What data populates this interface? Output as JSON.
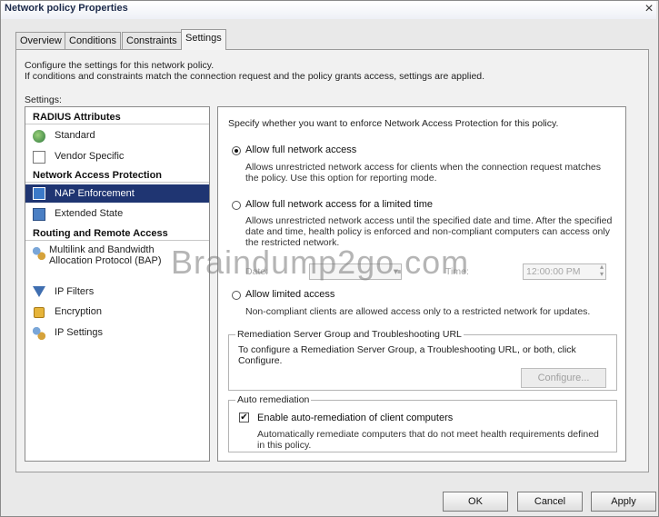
{
  "window": {
    "title": "Network policy Properties",
    "close_glyph": "×"
  },
  "tabs": [
    "Overview",
    "Conditions",
    "Constraints",
    "Settings"
  ],
  "active_tab": "Settings",
  "intro": {
    "line1": "Configure the settings for this network policy.",
    "line2": "If conditions and constraints match the connection request and the policy grants access, settings are applied."
  },
  "settings_label": "Settings:",
  "sidebar": {
    "sections": [
      {
        "title": "RADIUS Attributes",
        "items": [
          "Standard",
          "Vendor Specific"
        ]
      },
      {
        "title": "Network Access Protection",
        "items": [
          "NAP Enforcement",
          "Extended State"
        ]
      },
      {
        "title": "Routing and Remote Access",
        "items": [
          "Multilink and Bandwidth Allocation Protocol (BAP)",
          "IP Filters",
          "Encryption",
          "IP Settings"
        ]
      }
    ],
    "bap_line1": "Multilink and Bandwidth",
    "bap_line2": "Allocation Protocol (BAP)",
    "selected": "NAP Enforcement"
  },
  "main": {
    "heading": "Specify whether you want to enforce Network Access Protection for this policy.",
    "options": [
      {
        "label": "Allow full network access",
        "desc1": "Allows unrestricted network access for clients when the connection request matches",
        "desc2": "the policy.  Use this option for reporting mode.",
        "selected": true
      },
      {
        "label": "Allow full network access for a limited time",
        "desc1": "Allows unrestricted network access until the specified date and time. After the specified",
        "desc2": "date and time, health policy is enforced and non-compliant computers can access only",
        "desc3": "the restricted network.",
        "selected": false
      },
      {
        "label": "Allow limited access",
        "desc1": "Non-compliant clients are allowed access only to a restricted network for updates.",
        "selected": false
      }
    ],
    "date_label": "Date:",
    "time_label": "Time:",
    "time_value": "12:00:00 PM",
    "remediation": {
      "legend": "Remediation Server Group and Troubleshooting URL",
      "text1": "To configure a Remediation Server Group, a Troubleshooting URL, or both, click",
      "text2": "Configure.",
      "button": "Configure..."
    },
    "auto": {
      "legend": "Auto remediation",
      "checkbox_label": "Enable auto-remediation of client computers",
      "checked": true,
      "desc1": "Automatically remediate computers that do not meet health requirements defined",
      "desc2": "in this policy."
    }
  },
  "footer": {
    "ok": "OK",
    "cancel": "Cancel",
    "apply": "Apply"
  },
  "watermark": "Braindump2go.com",
  "colors": {
    "selection": "#1f3572",
    "title_text": "#1c2a4a"
  }
}
